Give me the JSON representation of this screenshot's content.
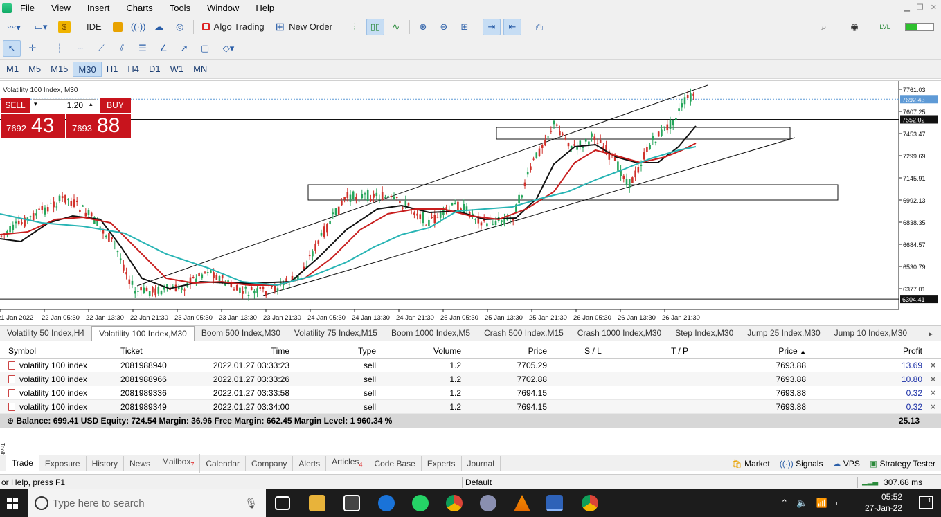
{
  "menu": [
    "File",
    "View",
    "Insert",
    "Charts",
    "Tools",
    "Window",
    "Help"
  ],
  "toolbar1": {
    "ide": "IDE",
    "algo_trading": "Algo Trading",
    "new_order": "New Order"
  },
  "timeframes": [
    "M1",
    "M5",
    "M15",
    "M30",
    "H1",
    "H4",
    "D1",
    "W1",
    "MN"
  ],
  "active_timeframe": "M30",
  "chart": {
    "title": "Volatility 100 Index, M30",
    "one_click": {
      "sell_label": "SELL",
      "buy_label": "BUY",
      "lot": "1.20",
      "sell_small": "7692",
      "sell_big": "43",
      "buy_small": "7693",
      "buy_big": "88"
    },
    "price_ticks": [
      "7761.03",
      "7607.25",
      "7453.47",
      "7299.69",
      "7145.91",
      "6992.13",
      "6838.35",
      "6684.57",
      "6530.79",
      "6377.01"
    ],
    "price_labels": {
      "bid": "7692.43",
      "line_high": "7552.02",
      "line_low": "6304.41"
    },
    "time_ticks": [
      "21 Jan 2022",
      "22 Jan 05:30",
      "22 Jan 13:30",
      "22 Jan 21:30",
      "23 Jan 05:30",
      "23 Jan 13:30",
      "23 Jan 21:30",
      "24 Jan 05:30",
      "24 Jan 13:30",
      "24 Jan 21:30",
      "25 Jan 05:30",
      "25 Jan 13:30",
      "25 Jan 21:30",
      "26 Jan 05:30",
      "26 Jan 13:30",
      "26 Jan 21:30"
    ],
    "colors": {
      "bull": "#26a65b",
      "bear": "#d0302a",
      "ma_black": "#111111",
      "ma_red": "#c81e1e",
      "ma_teal": "#27b4b4",
      "bid_line": "#5e9ad6"
    }
  },
  "symbol_tabs": [
    "Volatility 50 Index,H4",
    "Volatility 100 Index,M30",
    "Boom 500 Index,M30",
    "Volatility 75 Index,M15",
    "Boom 1000 Index,M5",
    "Crash 500 Index,M15",
    "Crash 1000 Index,M30",
    "Step Index,M30",
    "Jump 25 Index,M30",
    "Jump 10 Index,M30"
  ],
  "active_symbol_tab": 1,
  "table": {
    "headers": [
      "Symbol",
      "Ticket",
      "Time",
      "Type",
      "Volume",
      "Price",
      "S / L",
      "T / P",
      "Price",
      "Profit"
    ],
    "rows": [
      {
        "symbol": "volatility 100 index",
        "ticket": "2081988940",
        "time": "2022.01.27 03:33:23",
        "type": "sell",
        "volume": "1.2",
        "price": "7705.29",
        "sl": "",
        "tp": "",
        "cur": "7693.88",
        "profit": "13.69"
      },
      {
        "symbol": "volatility 100 index",
        "ticket": "2081988966",
        "time": "2022.01.27 03:33:26",
        "type": "sell",
        "volume": "1.2",
        "price": "7702.88",
        "sl": "",
        "tp": "",
        "cur": "7693.88",
        "profit": "10.80"
      },
      {
        "symbol": "volatility 100 index",
        "ticket": "2081989336",
        "time": "2022.01.27 03:33:58",
        "type": "sell",
        "volume": "1.2",
        "price": "7694.15",
        "sl": "",
        "tp": "",
        "cur": "7693.88",
        "profit": "0.32"
      },
      {
        "symbol": "volatility 100 index",
        "ticket": "2081989349",
        "time": "2022.01.27 03:34:00",
        "type": "sell",
        "volume": "1.2",
        "price": "7694.15",
        "sl": "",
        "tp": "",
        "cur": "7693.88",
        "profit": "0.32"
      }
    ],
    "balance_line": "Balance: 699.41 USD  Equity: 724.54  Margin: 36.96  Free Margin: 662.45  Margin Level: 1 960.34 %",
    "total_profit": "25.13"
  },
  "bottom_tabs": [
    {
      "label": "Trade",
      "badge": ""
    },
    {
      "label": "Exposure",
      "badge": ""
    },
    {
      "label": "History",
      "badge": ""
    },
    {
      "label": "News",
      "badge": ""
    },
    {
      "label": "Mailbox",
      "badge": "7"
    },
    {
      "label": "Calendar",
      "badge": ""
    },
    {
      "label": "Company",
      "badge": ""
    },
    {
      "label": "Alerts",
      "badge": ""
    },
    {
      "label": "Articles",
      "badge": "4"
    },
    {
      "label": "Code Base",
      "badge": ""
    },
    {
      "label": "Experts",
      "badge": ""
    },
    {
      "label": "Journal",
      "badge": ""
    }
  ],
  "bottom_right": {
    "market": "Market",
    "signals": "Signals",
    "vps": "VPS",
    "tester": "Strategy Tester"
  },
  "toolbox_label": "Toolbox",
  "status": {
    "help": "or Help, press F1",
    "profile": "Default",
    "ping": "307.68 ms"
  },
  "taskbar": {
    "search_placeholder": "Type here to search",
    "time": "05:52",
    "date": "27-Jan-22",
    "notif": "1"
  }
}
